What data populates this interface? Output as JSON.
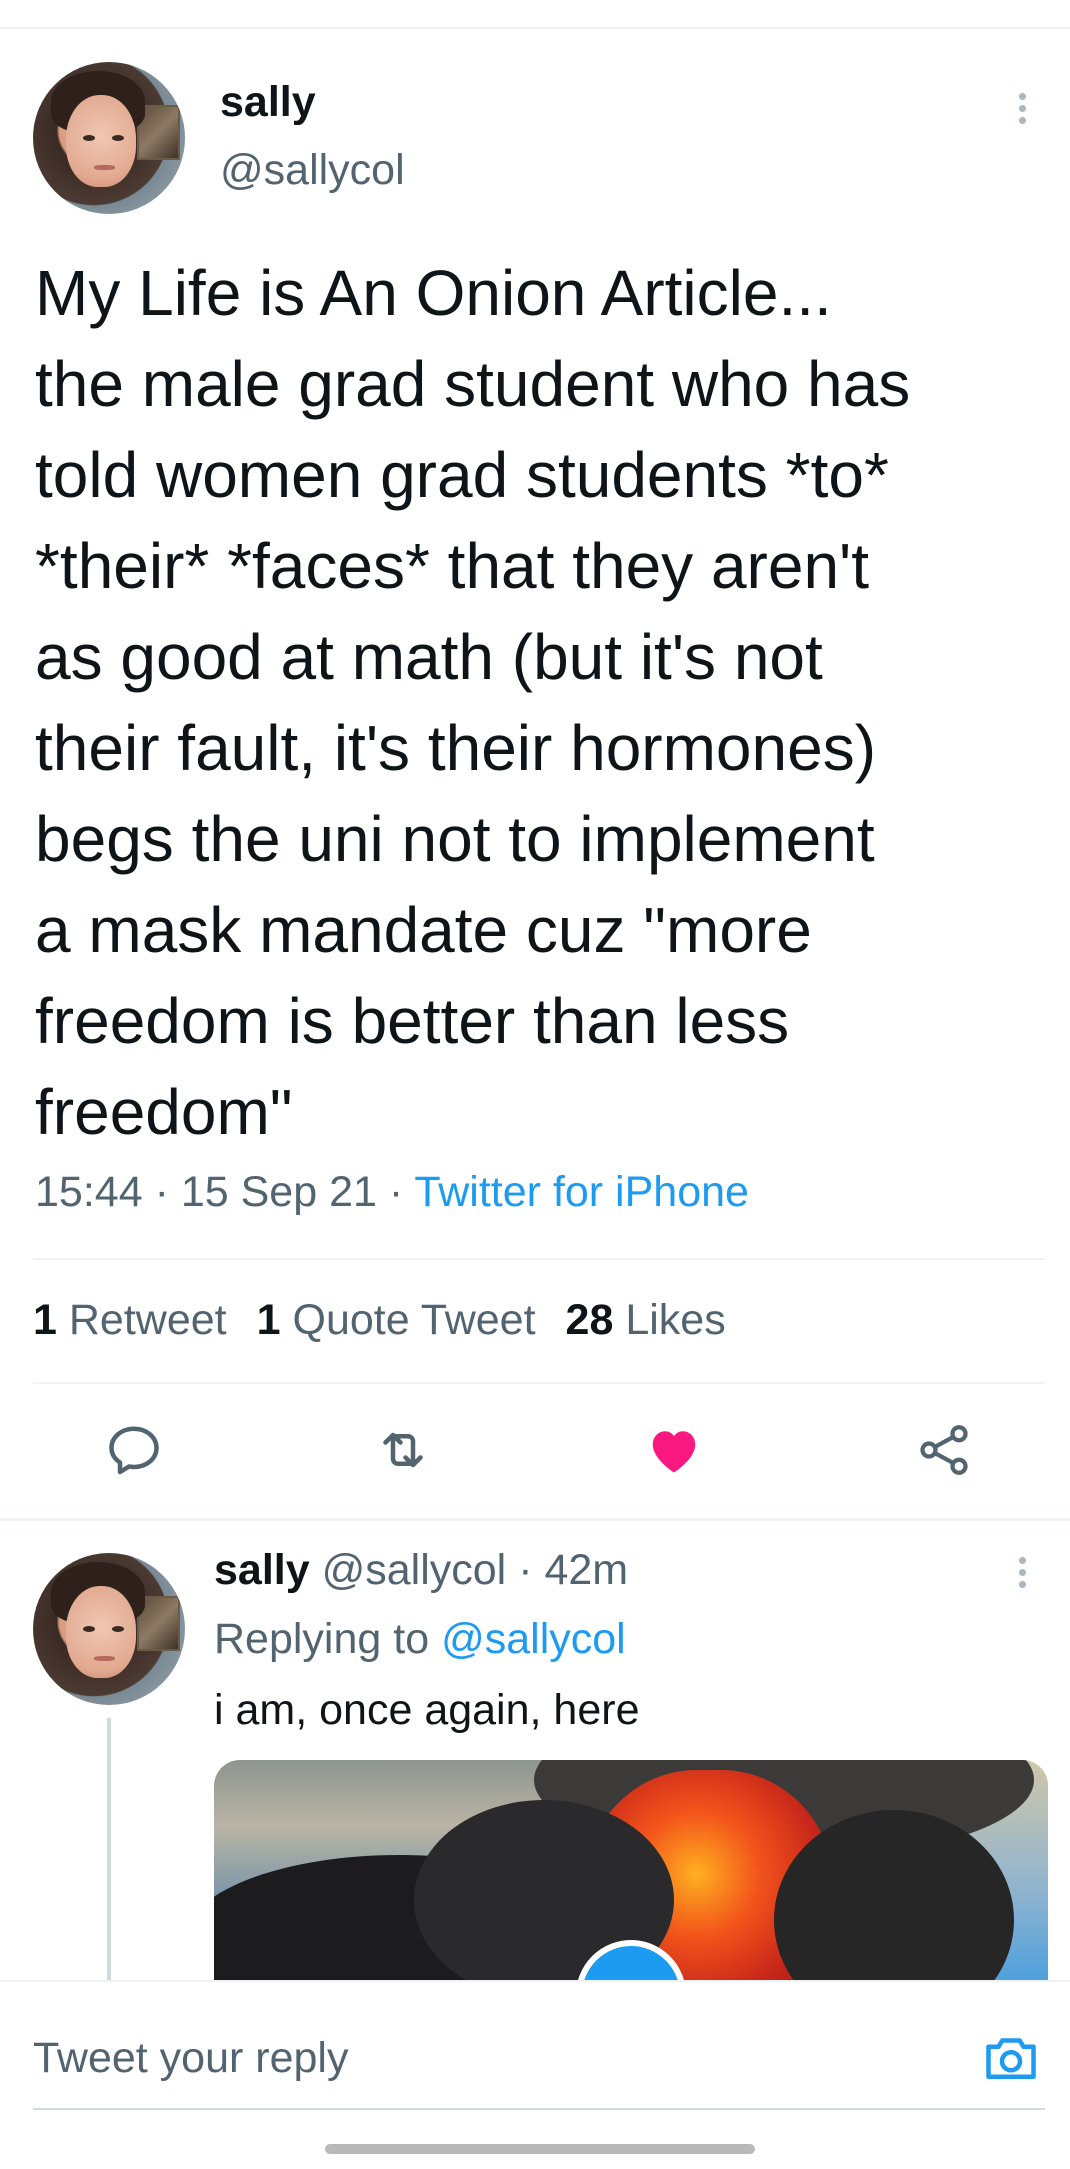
{
  "tweet": {
    "display_name": "sally",
    "handle": "@sallycol",
    "text": "My Life is An Onion Article...\nthe male grad student who has\ntold women grad students *to*\n*their* *faces* that they aren't\nas good at math (but it's not\ntheir fault, it's their hormones)\nbegs the uni not to implement\na mask mandate cuz \"more\nfreedom is better than less\nfreedom\"",
    "time": "15:44",
    "separator1": "·",
    "date": "15 Sep 21",
    "separator2": "·",
    "source": "Twitter for iPhone"
  },
  "stats": {
    "retweets_count": "1",
    "retweets_label": "Retweet",
    "quotes_count": "1",
    "quotes_label": "Quote Tweet",
    "likes_count": "28",
    "likes_label": "Likes"
  },
  "actions": {
    "reply_icon": "reply-icon",
    "retweet_icon": "retweet-icon",
    "like_icon": "heart-icon",
    "share_icon": "share-icon",
    "like_color": "#f91880",
    "icon_color": "#536471"
  },
  "reply": {
    "display_name": "sally",
    "handle": "@sallycol",
    "separator": "·",
    "age": "42m",
    "replying_prefix": "Replying to",
    "replying_to": "@sallycol",
    "text": "i am, once again, here"
  },
  "compose": {
    "placeholder": "Tweet your reply",
    "camera_icon": "camera-icon"
  },
  "colors": {
    "accent": "#1d9bf0",
    "secondary_text": "#536471",
    "primary_text": "#0f1419"
  }
}
